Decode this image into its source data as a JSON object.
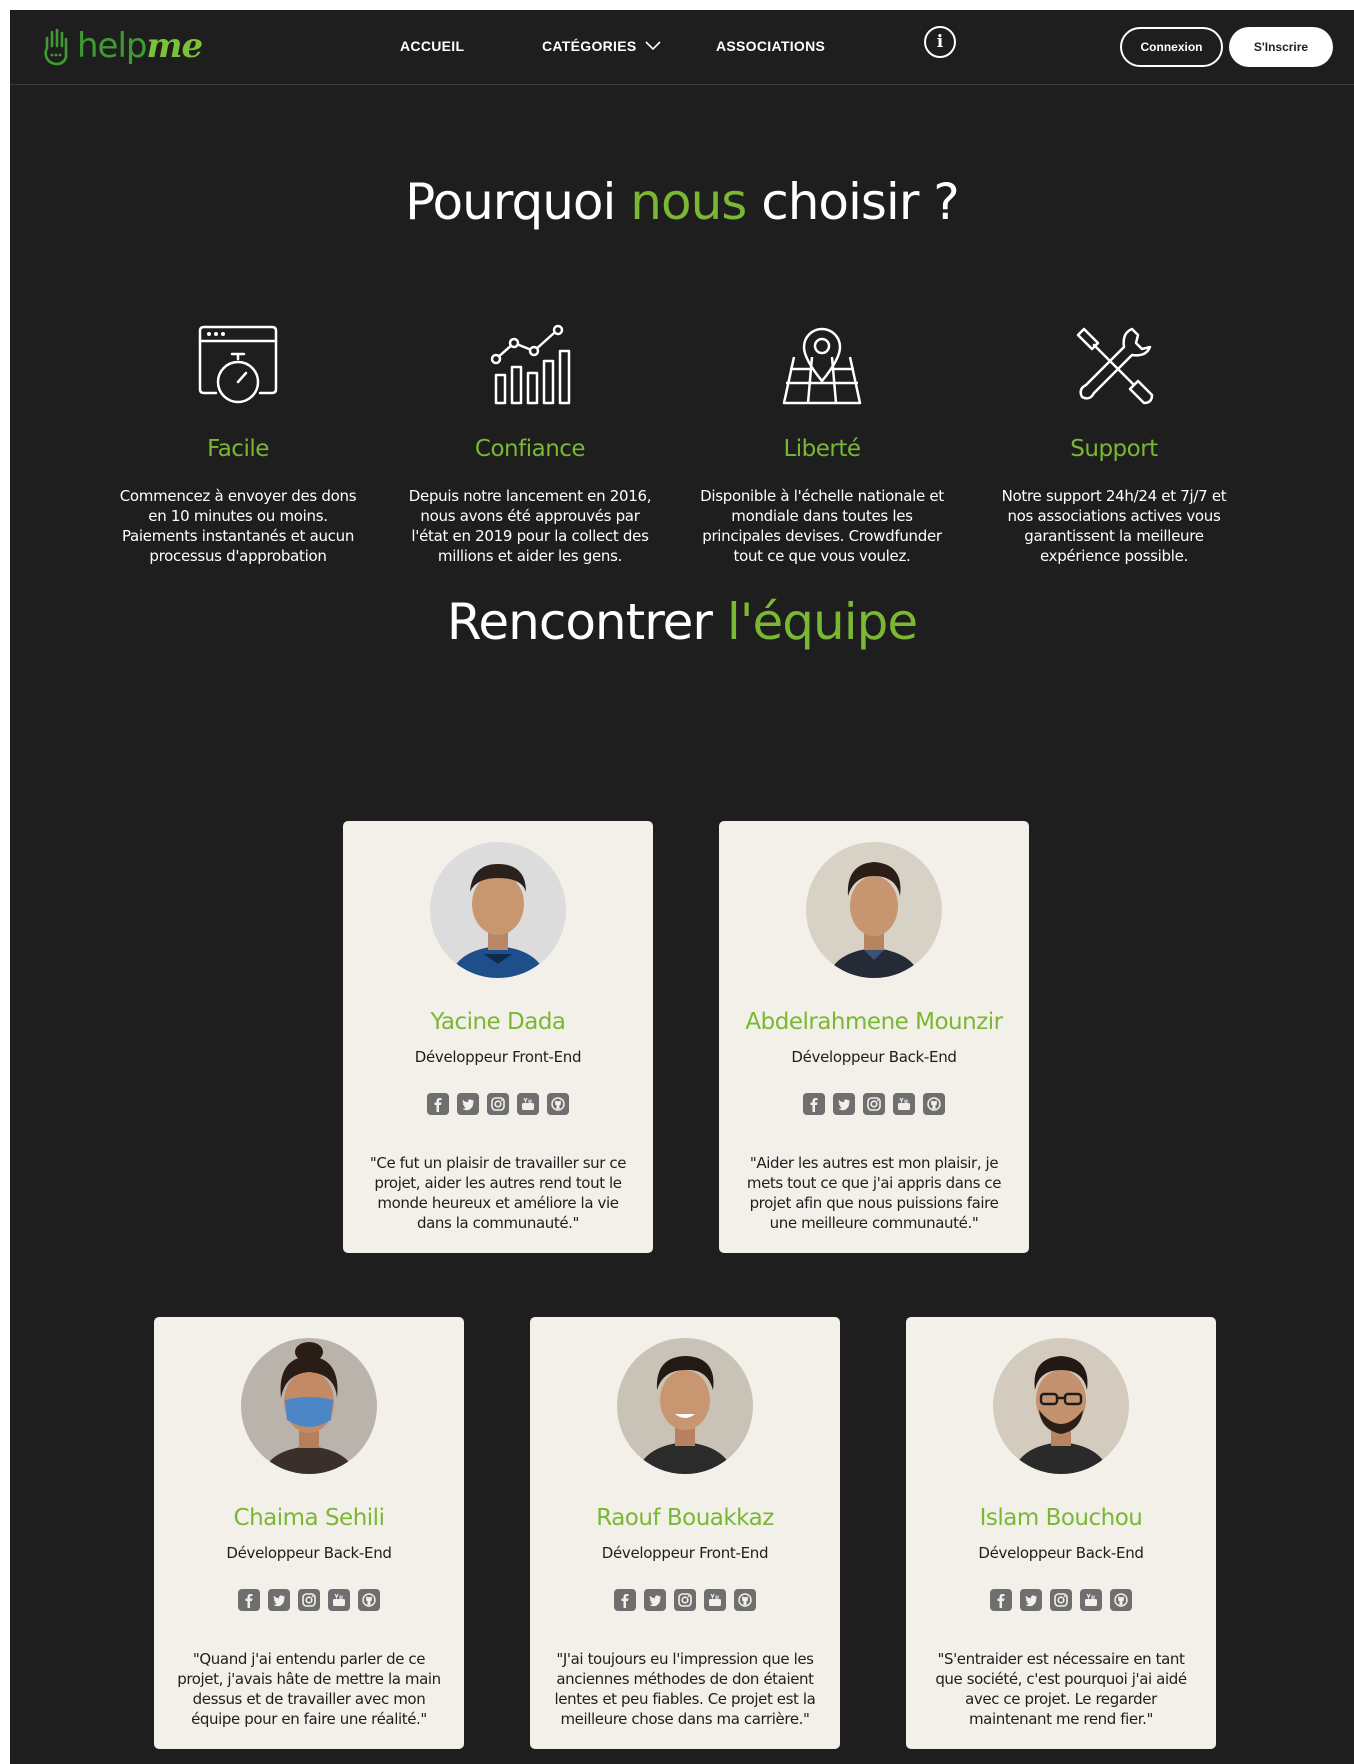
{
  "brand": {
    "help": "help",
    "me": "me",
    "icon": "raised-hand-icon"
  },
  "nav": {
    "home": "ACCUEIL",
    "categories": "CATÉGORIES",
    "associations": "ASSOCIATIONS",
    "info_icon": "info-icon",
    "login": "Connexion",
    "signup": "S'Inscrire"
  },
  "why": {
    "title_part1": "Pourquoi ",
    "title_highlight": "nous",
    "title_part2": " choisir ?",
    "features": [
      {
        "icon": "browser-stopwatch-icon",
        "title": "Facile",
        "description": "Commencez à envoyer des dons en 10 minutes ou moins. Paiements instantanés et aucun processus d'approbation"
      },
      {
        "icon": "growth-chart-icon",
        "title": "Confiance",
        "description": "Depuis notre lancement en 2016, nous avons été approuvés par l'état en 2019 pour la collect des millions et aider les gens."
      },
      {
        "icon": "map-pin-icon",
        "title": "Liberté",
        "description": "Disponible à l'échelle nationale et mondiale dans toutes les principales devises. Crowdfunder tout ce que vous voulez."
      },
      {
        "icon": "crossed-tools-icon",
        "title": "Support",
        "description": "Notre support 24h/24 et 7j/7 et nos associations actives vous garantissent la meilleure expérience possible."
      }
    ]
  },
  "team": {
    "title_part1": "Rencontrer ",
    "title_highlight": "l'équipe",
    "social_icons": [
      "facebook-icon",
      "twitter-icon",
      "instagram-icon",
      "youtube-icon",
      "github-icon"
    ],
    "members": [
      {
        "name": "Yacine Dada",
        "role": "Développeur Front-End",
        "quote": "\"Ce fut un plaisir de travailler sur ce projet, aider les autres rend tout le monde heureux et améliore la vie dans la communauté.\""
      },
      {
        "name": "Abdelrahmene Mounzir",
        "role": "Développeur Back-End",
        "quote": "\"Aider les autres est mon plaisir, je mets tout ce que j'ai appris dans ce projet afin que nous puissions faire une meilleure communauté.\""
      },
      {
        "name": "Chaima Sehili",
        "role": "Développeur Back-End",
        "quote": "\"Quand j'ai entendu parler de ce projet, j'avais hâte de mettre la main dessus et de travailler avec mon équipe pour en faire une réalité.\""
      },
      {
        "name": "Raouf Bouakkaz",
        "role": "Développeur Front-End",
        "quote": "\"J'ai toujours eu l'impression que les anciennes méthodes de don étaient lentes et peu fiables. Ce projet est la meilleure chose dans ma carrière.\""
      },
      {
        "name": "Islam Bouchou",
        "role": "Développeur Back-End",
        "quote": "\"S'entraider est nécessaire en tant que société, c'est pourquoi j'ai aidé avec ce projet. Le regarder maintenant me rend fier.\""
      }
    ]
  },
  "colors": {
    "accent": "#7ab733",
    "background": "#1e1e1e",
    "card": "#f3f0ea",
    "logo_dark_green": "#3f9a34"
  }
}
